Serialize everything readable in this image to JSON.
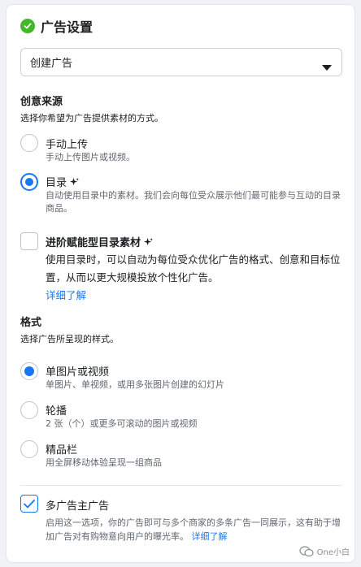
{
  "header": {
    "title": "广告设置",
    "icon": "check-circle-icon",
    "icon_color": "#42b72a"
  },
  "dropdown": {
    "value": "创建广告",
    "icon": "caret-down-icon"
  },
  "creative_source": {
    "title": "创意来源",
    "subtitle": "选择你希望为广告提供素材的方式。",
    "options": [
      {
        "label": "手动上传",
        "description": "手动上传图片或视频。",
        "selected": false
      },
      {
        "label": "目录",
        "description": "自动使用目录中的素材。我们会向每位受众展示他们最可能参与互动的目录商品。",
        "selected": true,
        "icon": "sparkle-icon"
      }
    ],
    "advanced": {
      "label": "进阶赋能型目录素材",
      "icon": "sparkle-icon",
      "checked": false,
      "description": "使用目录时，可以自动为每位受众优化广告的格式、创意和目标位置，从而以更大规模投放个性化广告。",
      "link": "详细了解"
    }
  },
  "format": {
    "title": "格式",
    "subtitle": "选择广告所呈现的样式。",
    "options": [
      {
        "label": "单图片或视频",
        "description": "单图片、单视频，或用多张图片创建的幻灯片",
        "selected": true
      },
      {
        "label": "轮播",
        "description": "2 张（个）或更多可滚动的图片或视频",
        "selected": false
      },
      {
        "label": "精品栏",
        "description": "用全屏移动体验呈现一组商品",
        "selected": false
      }
    ]
  },
  "multi_advertiser": {
    "label": "多广告主广告",
    "checked": true,
    "description": "启用这一选项，你的广告即可与多个商家的多条广告一同展示，这有助于增加广告对有购物意向用户的曝光率。",
    "link": "详细了解"
  },
  "watermark": {
    "text": "One小白",
    "icon": "wechat-icon"
  },
  "colors": {
    "accent": "#1877f2",
    "success": "#42b72a",
    "border": "#ccd0d5"
  }
}
